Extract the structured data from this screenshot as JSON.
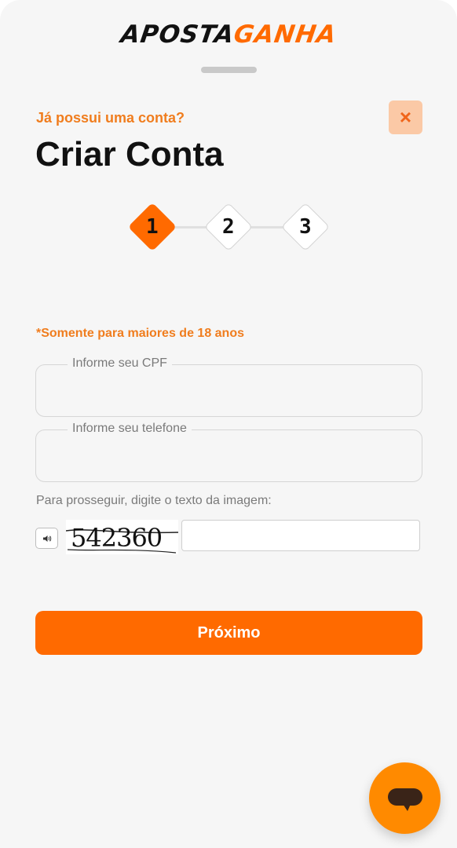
{
  "brand": {
    "part1": "APOSTA",
    "part2": "GANHA"
  },
  "header": {
    "already_have_account": "Já possui uma conta?",
    "title": "Criar Conta",
    "close_icon": "×"
  },
  "stepper": {
    "steps": [
      "1",
      "2",
      "3"
    ],
    "active_step": 1
  },
  "form": {
    "age_notice": "*Somente para maiores de 18 anos",
    "cpf_label": "Informe seu CPF",
    "cpf_value": "",
    "phone_label": "Informe seu telefone",
    "phone_value": "",
    "captcha_prompt": "Para prosseguir, digite o texto da imagem:",
    "captcha_image_text": "542360",
    "captcha_value": "",
    "audio_icon": "speaker-icon"
  },
  "actions": {
    "next_label": "Próximo"
  },
  "colors": {
    "accent": "#ff6a00",
    "accent_text": "#f07d1e",
    "close_bg": "#fbc9a6",
    "chat": "#ff8a00"
  }
}
